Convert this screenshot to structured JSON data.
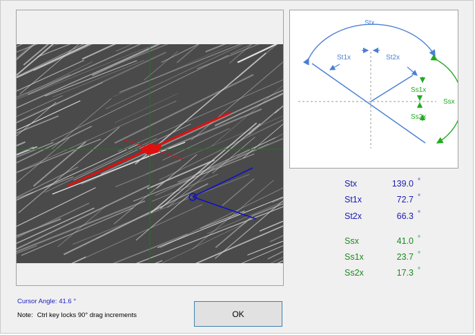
{
  "colors": {
    "blue_text": "#1a1ab4",
    "green_text": "#1a8a1a",
    "diagram_blue": "#4a7fd4",
    "diagram_green": "#22aa22",
    "axis_red": "#e01010",
    "cursor_blue": "#1010c8",
    "crosshair_green": "#1a7a1a"
  },
  "diagram": {
    "labels": {
      "stx": "Stx",
      "st1x": "St1x",
      "st2x": "St2x",
      "ss1x": "Ss1x",
      "ss2x": "Ss2x",
      "ssx": "Ssx"
    }
  },
  "angles": [
    {
      "name": "Stx",
      "value": "139.0",
      "unit": "°",
      "group": "blue"
    },
    {
      "name": "St1x",
      "value": "72.7",
      "unit": "°",
      "group": "blue"
    },
    {
      "name": "St2x",
      "value": "66.3",
      "unit": "°",
      "group": "blue"
    },
    {
      "name": "Ssx",
      "value": "41.0",
      "unit": "°",
      "group": "green"
    },
    {
      "name": "Ss1x",
      "value": "23.7",
      "unit": "°",
      "group": "green"
    },
    {
      "name": "Ss2x",
      "value": "17.3",
      "unit": "°",
      "group": "green"
    }
  ],
  "footer": {
    "cursor_angle": "Cursor Angle: 41.6 °",
    "note_label": "Note:",
    "note_text": "Ctrl key locks 90° drag increments",
    "ok_label": "OK"
  }
}
